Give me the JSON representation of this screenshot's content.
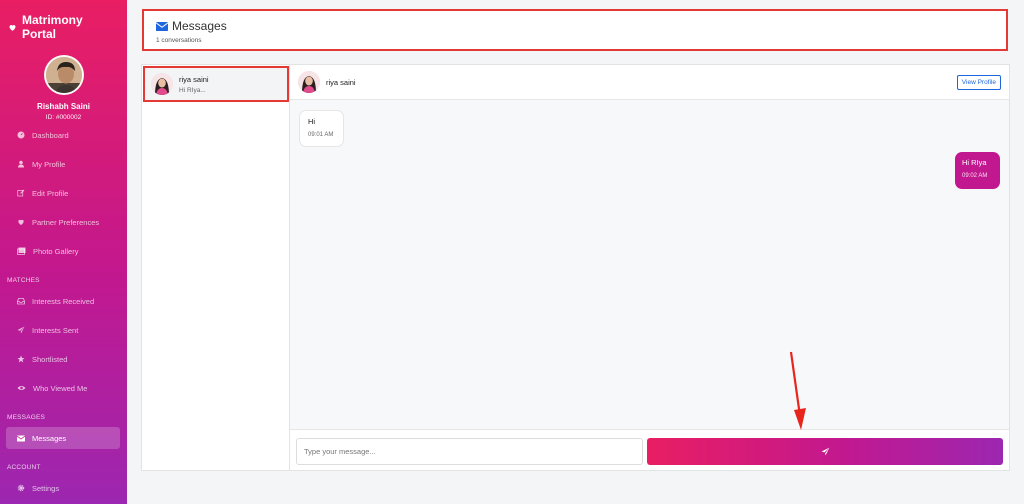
{
  "app": {
    "title": "Matrimony Portal",
    "brand_icon": "heart-icon"
  },
  "user": {
    "name": "Rishabh Saini",
    "id": "ID: #000002"
  },
  "nav": {
    "items": [
      {
        "label": "Dashboard",
        "icon": "dashboard-icon"
      },
      {
        "label": "My Profile",
        "icon": "user-icon"
      },
      {
        "label": "Edit Profile",
        "icon": "edit-icon"
      },
      {
        "label": "Partner Preferences",
        "icon": "heart-icon"
      },
      {
        "label": "Photo Gallery",
        "icon": "images-icon"
      }
    ],
    "section_matches": "MATCHES",
    "matches": [
      {
        "label": "Interests Received",
        "icon": "inbox-icon"
      },
      {
        "label": "Interests Sent",
        "icon": "paper-plane-icon"
      },
      {
        "label": "Shortlisted",
        "icon": "star-icon"
      },
      {
        "label": "Who Viewed Me",
        "icon": "eye-icon"
      }
    ],
    "section_messages": "MESSAGES",
    "messages": [
      {
        "label": "Messages",
        "icon": "envelope-icon",
        "active": true
      }
    ],
    "section_account": "ACCOUNT",
    "account": [
      {
        "label": "Settings",
        "icon": "gear-icon"
      }
    ]
  },
  "header": {
    "title": "Messages",
    "subtitle": "1 conversations",
    "icon": "envelope-icon"
  },
  "conversations": [
    {
      "name": "riya saini",
      "preview": "Hi RIya..."
    }
  ],
  "thread": {
    "name": "riya saini",
    "view_profile": "View Profile",
    "messages": [
      {
        "text": "Hi",
        "time": "09:01 AM",
        "direction": "in"
      },
      {
        "text": "Hi RIya",
        "time": "09:02 AM",
        "direction": "out"
      }
    ]
  },
  "composer": {
    "placeholder": "Type your message...",
    "send_icon": "paper-plane-icon"
  },
  "colors": {
    "brand_pink": "#e91e63",
    "brand_purple": "#9c27b0",
    "annotation_red": "#e53935",
    "link_blue": "#1e66e0"
  }
}
